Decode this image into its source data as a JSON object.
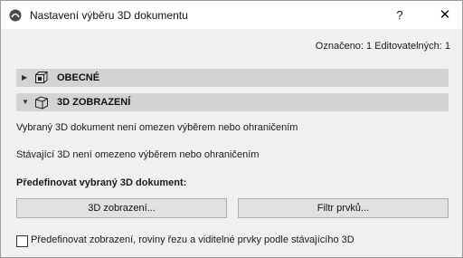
{
  "window": {
    "title": "Nastavení výběru 3D dokumentu",
    "help_label": "?",
    "close_label": "✕"
  },
  "selection_info": "Označeno: 1 Editovatelných: 1",
  "sections": [
    {
      "label": "OBECNÉ",
      "expanded": false,
      "icon": "general-settings-icon"
    },
    {
      "label": "3D ZOBRAZENÍ",
      "expanded": true,
      "icon": "3d-view-icon"
    }
  ],
  "view3d": {
    "status_document": "Vybraný 3D dokument není omezen výběrem nebo ohraničením",
    "status_current": "Stávající 3D není omezeno výběrem nebo ohraničením",
    "redefine_heading": "Předefinovat vybraný 3D dokument:",
    "button_3d_view": "3D zobrazení...",
    "button_element_filter": "Filtr prvků...",
    "checkbox_label": "Předefinovat zobrazení, roviny řezu a viditelné prvky podle stávajícího 3D",
    "checkbox_checked": false
  }
}
